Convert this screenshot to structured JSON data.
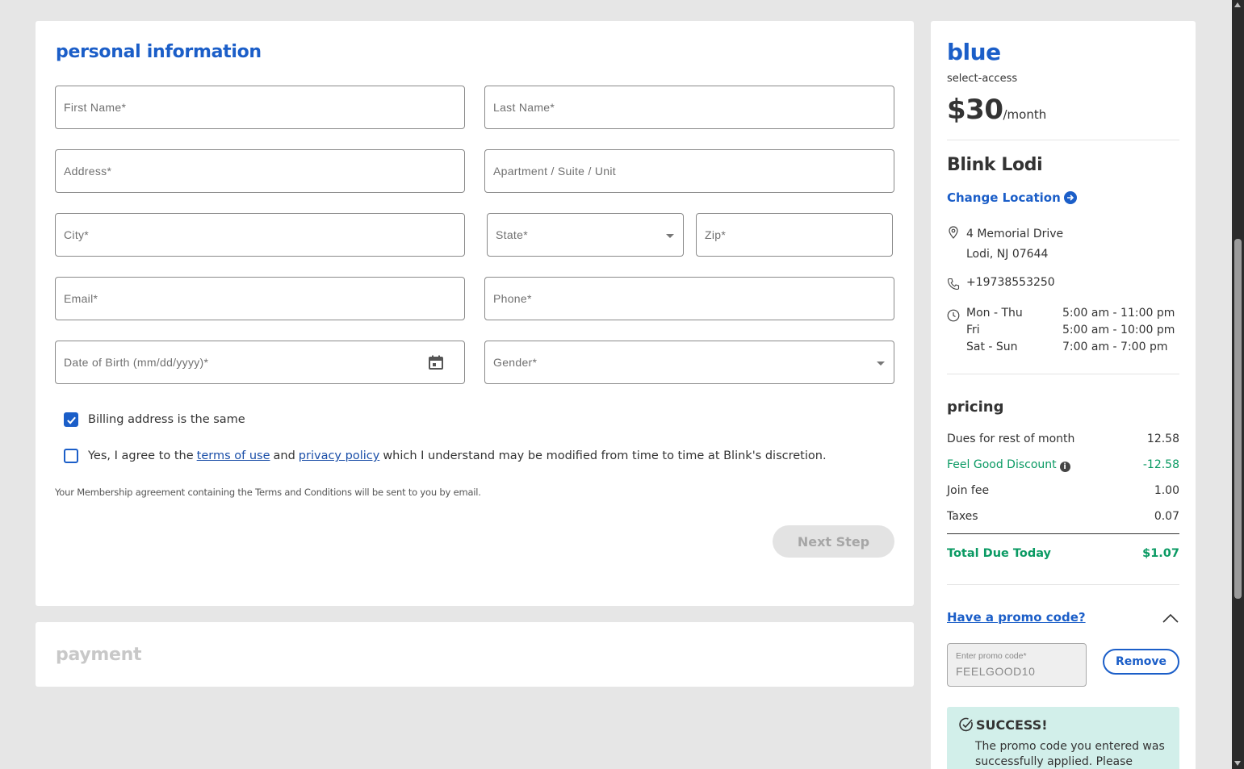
{
  "personal": {
    "title": "personal information",
    "fields": {
      "first_name": "First Name*",
      "last_name": "Last Name*",
      "address": "Address*",
      "apartment": "Apartment / Suite / Unit",
      "city": "City*",
      "state": "State*",
      "zip": "Zip*",
      "email": "Email*",
      "phone": "Phone*",
      "dob": "Date of Birth (mm/dd/yyyy)*",
      "gender": "Gender*"
    },
    "billing_same": {
      "label": "Billing address is the same",
      "checked": true
    },
    "agree": {
      "checked": false,
      "prefix": "Yes, I agree to the",
      "terms_link": "terms of use",
      "and": "and",
      "privacy_link": "privacy policy",
      "suffix": "which I understand may be modified from time to time at Blink's discretion."
    },
    "note": "Your Membership agreement containing the Terms and Conditions will be sent to you by email.",
    "next_button": "Next Step"
  },
  "payment": {
    "title": "payment"
  },
  "summary": {
    "plan_name": "blue",
    "plan_sub": "select-access",
    "price": "$30",
    "price_period": "/month",
    "location_name": "Blink Lodi",
    "change_location": "Change Location",
    "address_line1": "4 Memorial Drive",
    "address_line2": "Lodi, NJ 07644",
    "phone": "+19738553250",
    "hours": [
      {
        "days": "Mon - Thu",
        "time": "5:00 am - 11:00 pm"
      },
      {
        "days": "Fri",
        "time": "5:00 am - 10:00 pm"
      },
      {
        "days": "Sat - Sun",
        "time": "7:00 am - 7:00 pm"
      }
    ],
    "pricing_title": "pricing",
    "lines": [
      {
        "label": "Dues for rest of month",
        "value": "12.58"
      },
      {
        "label": "Feel Good Discount",
        "value": "-12.58"
      },
      {
        "label": "Join fee",
        "value": "1.00"
      },
      {
        "label": "Taxes",
        "value": "0.07"
      }
    ],
    "total_label": "Total Due Today",
    "total_value": "$1.07",
    "promo_link": "Have a promo code?",
    "promo_field_label": "Enter promo code*",
    "promo_value": "FEELGOOD10",
    "remove_button": "Remove",
    "success_title": "SUCCESS!",
    "success_message": "The promo code you entered was successfully applied. Please"
  },
  "colors": {
    "accent": "#1b5ec8",
    "success_green": "#0a9a63",
    "success_bg": "#d2efea"
  }
}
